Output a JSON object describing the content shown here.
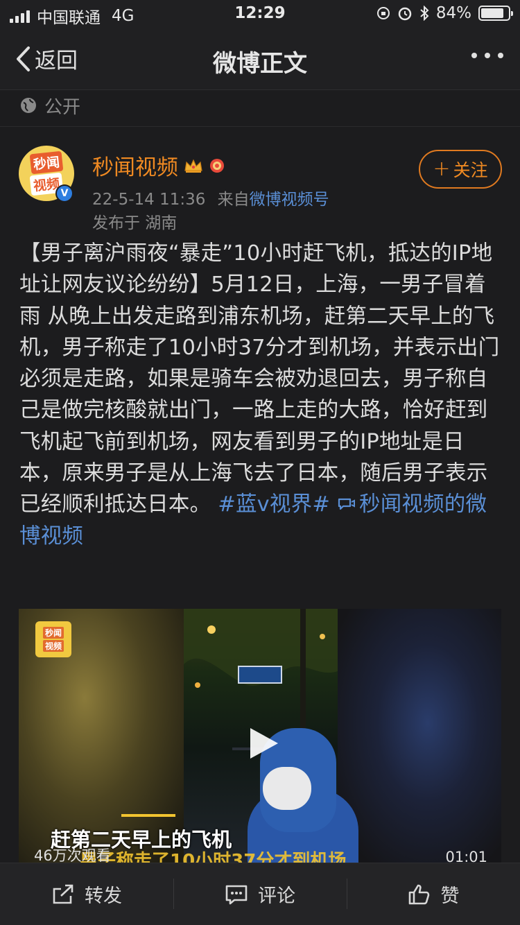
{
  "status_bar": {
    "carrier": "中国联通",
    "network": "4G",
    "time": "12:29",
    "battery": "84%",
    "battery_level": 0.84
  },
  "nav": {
    "back_label": "返回",
    "title": "微博正文"
  },
  "visibility": {
    "label": "公开"
  },
  "author": {
    "name": "秒闻视频",
    "avatar_text_line1": "秒闻",
    "avatar_text_line2": "视频",
    "date": "22-5-14 11:36",
    "from_prefix": "来自",
    "source": "微博视频号",
    "location": "发布于 湖南",
    "follow_label": "关注",
    "verified": "V"
  },
  "post": {
    "text": "【男子离沪雨夜“暴走”10小时赶飞机，抵达的IP地址让网友议论纷纷】5月12日，上海，一男子冒着雨 从晚上出发走路到浦东机场，赶第二天早上的飞机，男子称走了10小时37分才到机场，并表示出门必须是走路，如果是骑车会被劝退回去，男子称自己是做完核酸就出门，一路上走的大路，恰好赶到飞机起飞前到机场，网友看到男子的IP地址是日本，原来男子是从上海飞去了日本，随后男子表示已经顺利抵达日本。",
    "hashtag": "#蓝v视界#",
    "video_link": "秒闻视频的微博视频"
  },
  "video": {
    "logo_line1": "秒闻",
    "logo_line2": "视频",
    "caption": "赶第二天早上的飞机",
    "subtitle_partial": "男子称走了10小时37分才到机场",
    "views": "46万次观看",
    "duration": "01:01"
  },
  "toolbar": {
    "repost_label": "转发",
    "comment_label": "评论",
    "like_label": "赞"
  },
  "colors": {
    "background": "#1c1c1e",
    "accent_orange": "#f08a22",
    "link_blue": "#5a8fd6"
  }
}
